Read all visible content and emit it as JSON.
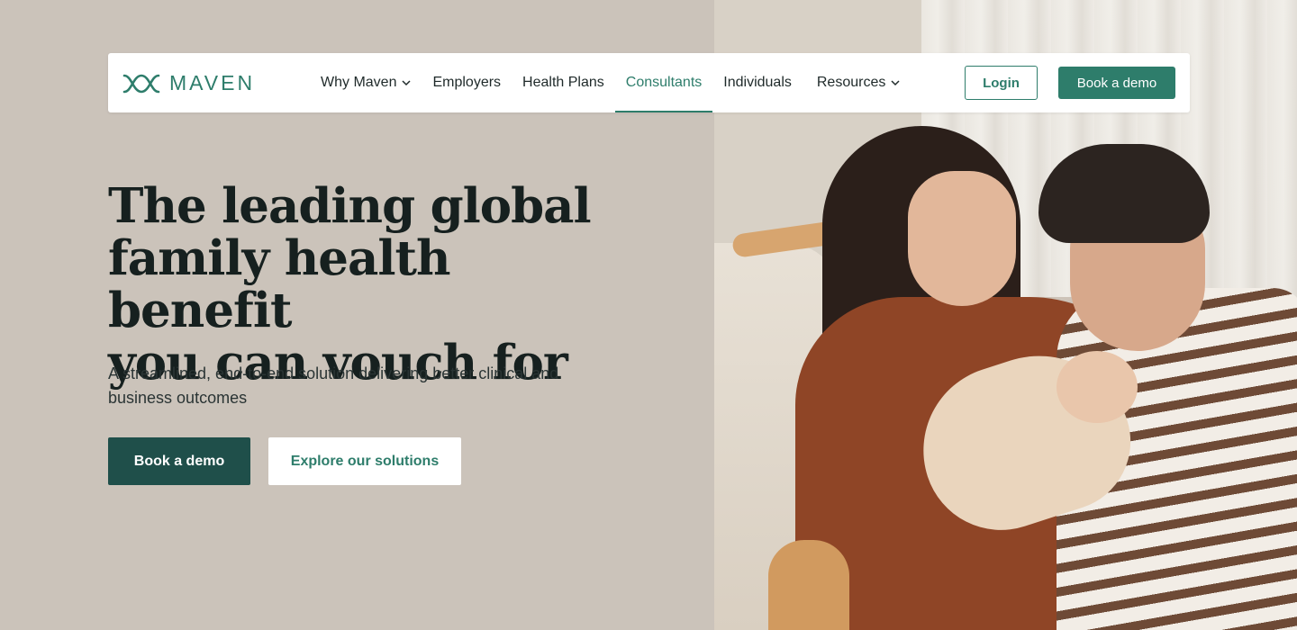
{
  "brand": {
    "name": "MAVEN",
    "accent_color": "#2e7d6b",
    "dark_color": "#1f4f4a",
    "background_color": "#cbc3ba"
  },
  "nav": {
    "items": [
      {
        "label": "Why Maven",
        "has_dropdown": true,
        "icon": "chevron-down-icon"
      },
      {
        "label": "Employers",
        "has_dropdown": false
      },
      {
        "label": "Health Plans",
        "has_dropdown": false
      },
      {
        "label": "Consultants",
        "has_dropdown": false,
        "active": true
      },
      {
        "label": "Individuals",
        "has_dropdown": false
      },
      {
        "label": "Resources",
        "has_dropdown": true,
        "icon": "chevron-down-icon"
      }
    ],
    "login_label": "Login",
    "book_demo_label": "Book a demo"
  },
  "hero": {
    "title_lines": [
      "The leading global",
      "family health benefit",
      "you can vouch for"
    ],
    "subtitle": "A streamlined, end-to-end solution delivering better clinical and business outcomes",
    "primary_cta": "Book a demo",
    "secondary_cta": "Explore our solutions"
  },
  "image": {
    "description_icon": "family-photo"
  }
}
